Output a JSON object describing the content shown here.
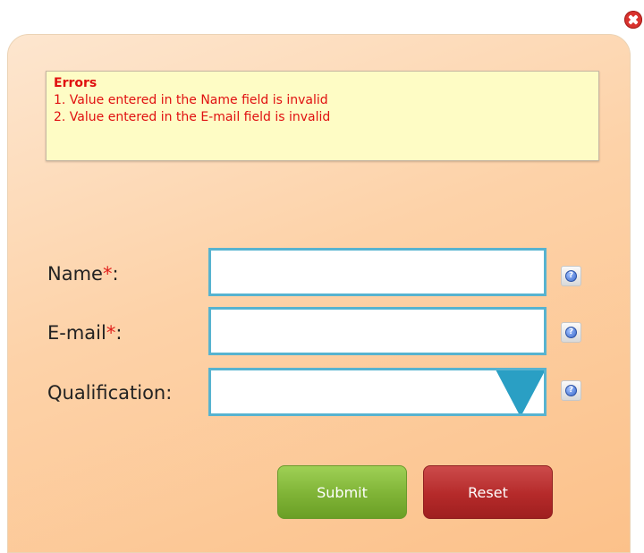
{
  "errors": {
    "title": "Errors",
    "items": [
      "1. Value entered in the Name field is invalid",
      "2. Value entered in the E-mail field is invalid"
    ]
  },
  "form": {
    "name_label": "Name",
    "email_label": "E-mail",
    "qualification_label": "Qualification:",
    "required_marker": "*",
    "label_suffix": ":",
    "name_value": "",
    "email_value": "",
    "qualification_value": ""
  },
  "buttons": {
    "submit_label": "Submit",
    "reset_label": "Reset"
  },
  "colors": {
    "panel_gradient_start": "#fde6cf",
    "panel_gradient_end": "#fcc18a",
    "error_text": "#e01010",
    "field_border": "#57b3d0",
    "submit": "#7fb336",
    "reset": "#b52a2a"
  }
}
